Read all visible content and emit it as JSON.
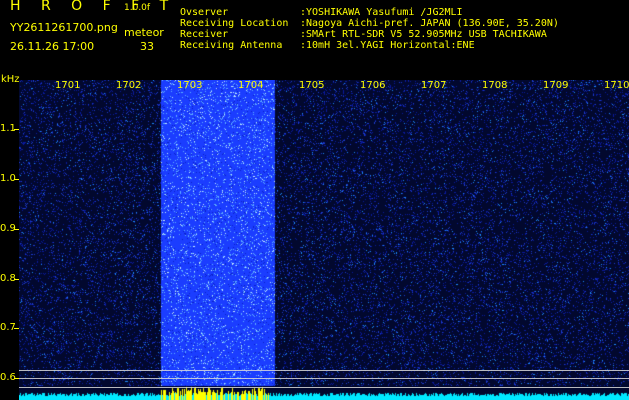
{
  "header": {
    "brand": "H R O F F T",
    "version": "1.0.0f",
    "filename": "YY2611261700.png",
    "meteor_label": "meteor",
    "datetime": "26.11.26 17:00",
    "meteor_count": "33"
  },
  "info": [
    {
      "key": "Ovserver",
      "value": ":YOSHIKAWA Yasufumi /JG2MLI"
    },
    {
      "key": "Receiving Location",
      "value": ":Nagoya Aichi-pref. JAPAN (136.90E, 35.20N)"
    },
    {
      "key": "Receiver",
      "value": ":SMArt RTL-SDR V5 52.905MHz USB TACHIKAWA"
    },
    {
      "key": "Receiving Antenna",
      "value": ":10mH 3el.YAGI Horizontal:ENE"
    }
  ],
  "axis": {
    "y_unit": "kHz",
    "y_ticks": [
      "1.1",
      "1.0",
      "0.9",
      "0.8",
      "0.7",
      "0.6"
    ],
    "x_ticks": [
      "1701",
      "1702",
      "1703",
      "1704",
      "1705",
      "1706",
      "1707",
      "1708",
      "1709",
      "1710"
    ]
  },
  "spectrogram": {
    "meteor_band_minutes": [
      1703,
      1704
    ],
    "background_color": "#02082e",
    "band_color": "#1b3dff",
    "noise_color": "#1d8dff",
    "baseline_color": "#00e8ff",
    "burst_color": "#ffff00"
  }
}
